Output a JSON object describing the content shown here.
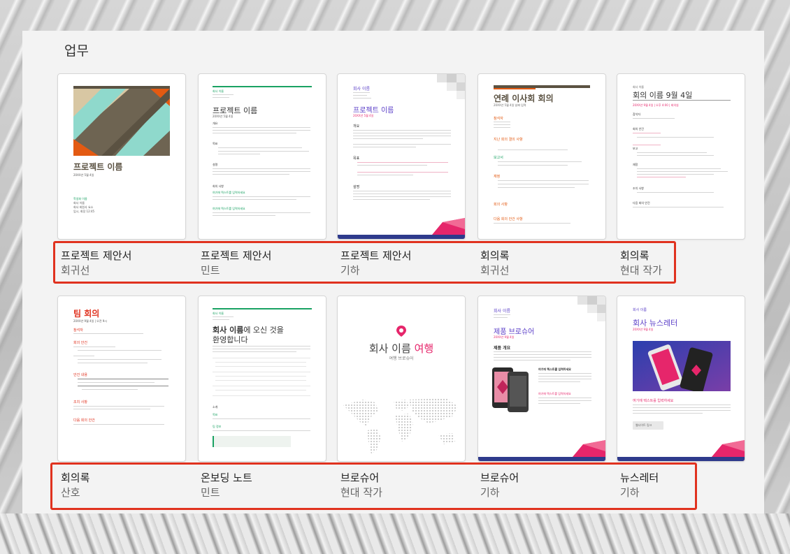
{
  "section": {
    "title": "업무"
  },
  "row1": [
    {
      "name": "프로젝트 제안서",
      "style": "회귀선",
      "thumb": {
        "title": "프로젝트 이름",
        "date": "20XX년 5월 4일",
        "author": "학생회 이름",
        "lines": [
          "회사 이름",
          "회사 회원사 요소",
          "입시, 회장 12:45"
        ]
      }
    },
    {
      "name": "프로젝트 제안서",
      "style": "민트",
      "thumb": {
        "company": "회사 이름",
        "title": "프로젝트 이름",
        "date": "20XX년 5월 4일",
        "sections": [
          "개요",
          "목표",
          "설명",
          "회의 사항"
        ],
        "accent": "여기에 텍스트를 입력하세요"
      }
    },
    {
      "name": "프로젝트 제안서",
      "style": "기하",
      "thumb": {
        "company": "회사 이름",
        "title": "프로젝트 이름",
        "date": "20XX년 5월 4일",
        "sections": [
          "개요",
          "목표",
          "설명"
        ]
      }
    },
    {
      "name": "회의록",
      "style": "회귀선",
      "thumb": {
        "title": "연례 이사회 회의",
        "date": "20XX년 5월 4일 날짜 입력",
        "sections": [
          "참석자",
          "지난 회의 결의 사항",
          "보고서",
          "재정",
          "회의 사항",
          "다음 회의 안건 사항"
        ]
      }
    },
    {
      "name": "회의록",
      "style": "현대 작가",
      "thumb": {
        "company": "회사 이름",
        "title": "회의 이름 9월 4일",
        "date": "20XX년 9월 4일 | 오후 4:00 | 회의실",
        "sections": [
          "참석자",
          "회의 안건",
          "보고",
          "재정",
          "조치 사항",
          "다음 회의 안건"
        ]
      }
    }
  ],
  "row2": [
    {
      "name": "회의록",
      "style": "산호",
      "thumb": {
        "title": "팀 회의",
        "date": "20XX년 9월 4일 | 오전 9시",
        "sections": [
          "참석자",
          "회의 안건",
          "안건 내용",
          "조치 사항",
          "다음 회의 안건"
        ]
      }
    },
    {
      "name": "온보딩 노트",
      "style": "민트",
      "thumb": {
        "company": "회사 이름",
        "title_a": "회사 이름",
        "title_b": "에 오신 것을",
        "title_c": "환영합니다",
        "sections": [
          "소개",
          "목표",
          "팀 정보"
        ]
      }
    },
    {
      "name": "브로슈어",
      "style": "현대 작가",
      "thumb": {
        "title_a": "회사 이름",
        "title_b": "여행",
        "subtitle": "여행 브로슈어"
      }
    },
    {
      "name": "브로슈어",
      "style": "기하",
      "thumb": {
        "company": "회사 이름",
        "title": "제품 브로슈어",
        "date": "20XX년 9월 4일",
        "heading": "제품 개요",
        "callout": "여기에 텍스트를 입력하세요"
      }
    },
    {
      "name": "뉴스레터",
      "style": "기하",
      "thumb": {
        "company": "회사 이름",
        "title": "회사 뉴스레터",
        "date": "20XX년 9월 4일",
        "heading": "여기에 텍스트를 입력하세요",
        "button": "웹사이트 링크"
      }
    }
  ],
  "colors": {
    "highlight": "#e0321f",
    "mint": "#1aa263",
    "coral": "#e0321f",
    "purple": "#5a3ec8",
    "pink": "#e6266b",
    "orange": "#e35a12"
  }
}
